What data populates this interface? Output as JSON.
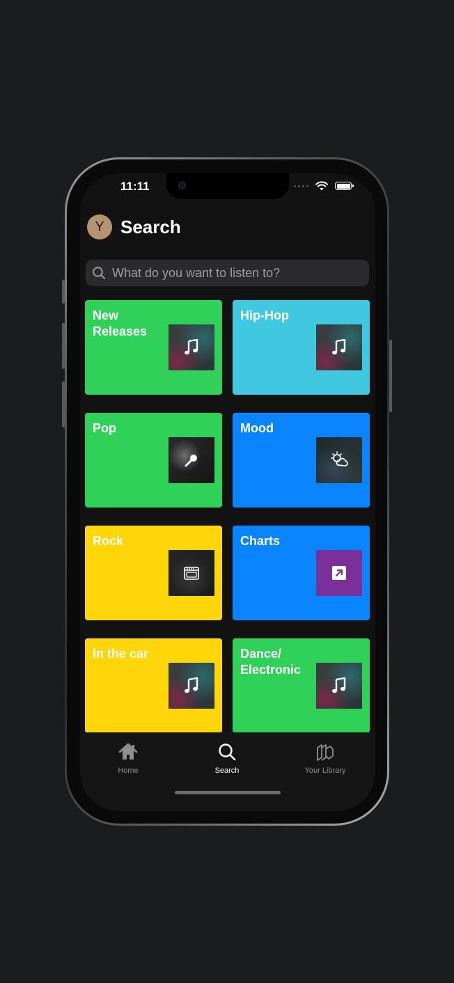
{
  "status_bar": {
    "time": "11:11"
  },
  "header": {
    "avatar_initial": "Y",
    "title": "Search"
  },
  "search": {
    "placeholder": "What do you want to listen to?"
  },
  "categories": [
    {
      "label": "New Releases",
      "color": "#30d158",
      "art": "music-note-icon"
    },
    {
      "label": "Hip-Hop",
      "color": "#40c8e0",
      "art": "music-note-icon"
    },
    {
      "label": "Pop",
      "color": "#30d158",
      "art": "microphone-icon"
    },
    {
      "label": "Mood",
      "color": "#0a84ff",
      "art": "cloud-sun-icon"
    },
    {
      "label": "Rock",
      "color": "#ffd60a",
      "art": "amplifier-icon"
    },
    {
      "label": "Charts",
      "color": "#0a84ff",
      "art": "arrow-up-right-icon"
    },
    {
      "label": "In the car",
      "color": "#ffd60a",
      "art": "music-note-icon"
    },
    {
      "label": "Dance/ Electronic",
      "color": "#30d158",
      "art": "music-note-icon"
    }
  ],
  "tabbar": {
    "home": "Home",
    "search": "Search",
    "library": "Your Library"
  },
  "colors": {
    "background": "#121212",
    "accent_green": "#30d158",
    "accent_blue": "#0a84ff",
    "accent_yellow": "#ffd60a",
    "accent_cyan": "#40c8e0",
    "avatar": "#b49470"
  }
}
